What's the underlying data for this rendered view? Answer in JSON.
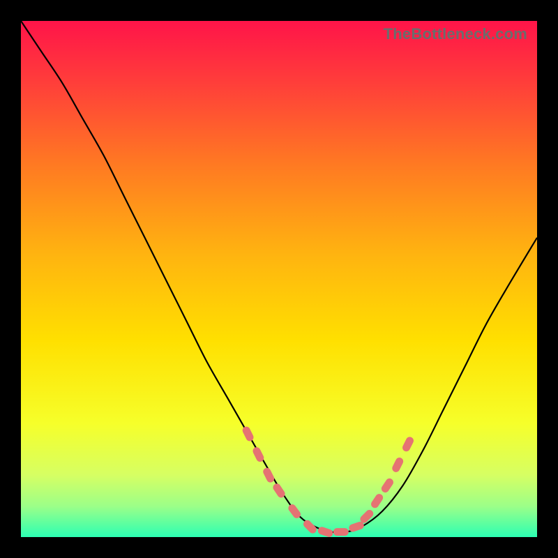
{
  "watermark": "TheBottleneck.com",
  "colors": {
    "bg_black": "#000000",
    "watermark_gray": "#6c6c6c",
    "curve": "#000000",
    "marker_fill": "#e57373",
    "marker_stroke": "#b74a4a",
    "gradient_stops": [
      {
        "offset": 0.0,
        "color": "#ff1449"
      },
      {
        "offset": 0.12,
        "color": "#ff3e3a"
      },
      {
        "offset": 0.28,
        "color": "#ff7a22"
      },
      {
        "offset": 0.45,
        "color": "#ffb310"
      },
      {
        "offset": 0.62,
        "color": "#ffe000"
      },
      {
        "offset": 0.78,
        "color": "#f6ff2a"
      },
      {
        "offset": 0.88,
        "color": "#d6ff63"
      },
      {
        "offset": 0.94,
        "color": "#9cff88"
      },
      {
        "offset": 1.0,
        "color": "#2cffb3"
      }
    ]
  },
  "chart_data": {
    "type": "line",
    "title": "",
    "xlabel": "",
    "ylabel": "",
    "xlim": [
      0,
      100
    ],
    "ylim": [
      0,
      100
    ],
    "grid": false,
    "series": [
      {
        "name": "bottleneck-curve",
        "x": [
          0,
          4,
          8,
          12,
          16,
          20,
          24,
          28,
          32,
          36,
          40,
          44,
          48,
          51,
          54,
          57,
          60,
          63,
          66,
          70,
          74,
          78,
          82,
          86,
          90,
          94,
          100
        ],
        "y": [
          100,
          94,
          88,
          81,
          74,
          66,
          58,
          50,
          42,
          34,
          27,
          20,
          13,
          8,
          4,
          2,
          1,
          1,
          2,
          5,
          10,
          17,
          25,
          33,
          41,
          48,
          58
        ]
      }
    ],
    "markers": {
      "name": "highlight-dots",
      "x": [
        44,
        46,
        48,
        50,
        53,
        56,
        59,
        62,
        65,
        67,
        69,
        71,
        73,
        75
      ],
      "y": [
        20,
        16,
        12,
        9,
        5,
        2,
        1,
        1,
        2,
        4,
        7,
        10,
        14,
        18
      ]
    }
  }
}
